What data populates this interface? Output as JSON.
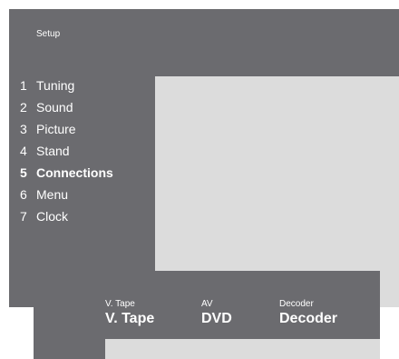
{
  "setup_menu": {
    "title": "Setup",
    "items": [
      {
        "number": "1",
        "label": "Tuning"
      },
      {
        "number": "2",
        "label": "Sound"
      },
      {
        "number": "3",
        "label": "Picture"
      },
      {
        "number": "4",
        "label": "Stand"
      },
      {
        "number": "5",
        "label": "Connections",
        "active": true
      },
      {
        "number": "6",
        "label": "Menu"
      },
      {
        "number": "7",
        "label": "Clock"
      }
    ]
  },
  "connections": {
    "columns": [
      {
        "label": "V. Tape",
        "value": "V. Tape"
      },
      {
        "label": "AV",
        "value": "DVD"
      },
      {
        "label": "Decoder",
        "value": "Decoder"
      }
    ]
  },
  "colors": {
    "panel_bg": "#6b6b6f",
    "content_bg": "#dcdcdc",
    "text": "#ffffff"
  }
}
